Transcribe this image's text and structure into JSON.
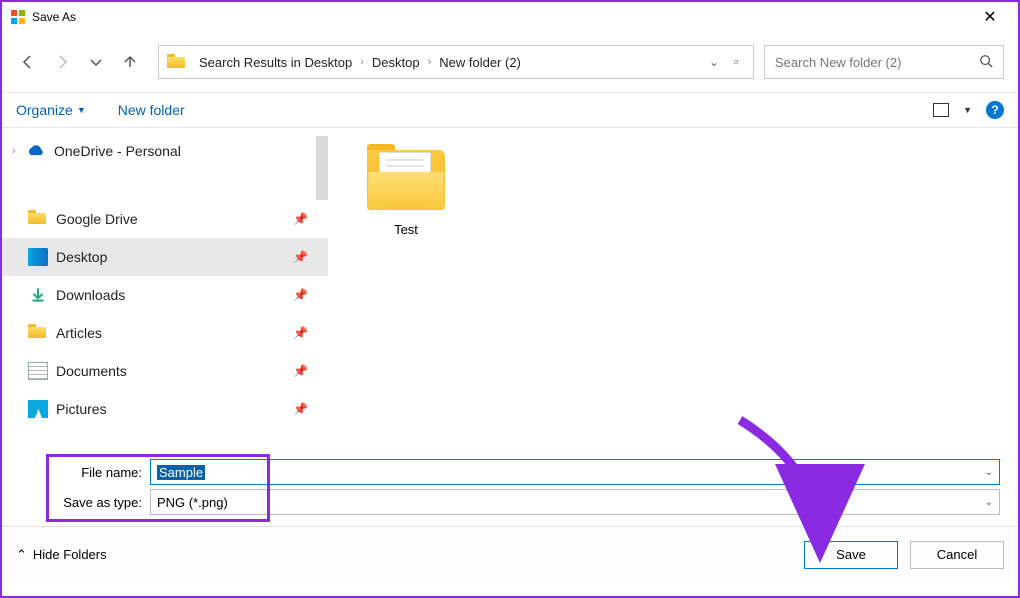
{
  "window": {
    "title": "Save As"
  },
  "breadcrumb": {
    "segments": [
      "Search Results in Desktop",
      "Desktop",
      "New folder (2)"
    ]
  },
  "search": {
    "placeholder": "Search New folder (2)"
  },
  "toolbar": {
    "organize": "Organize",
    "newfolder": "New folder"
  },
  "sidebar": {
    "onedrive": "OneDrive - Personal",
    "items": [
      {
        "label": "Google Drive"
      },
      {
        "label": "Desktop"
      },
      {
        "label": "Downloads"
      },
      {
        "label": "Articles"
      },
      {
        "label": "Documents"
      },
      {
        "label": "Pictures"
      }
    ]
  },
  "content": {
    "items": [
      {
        "label": "Test"
      }
    ]
  },
  "fields": {
    "filename_label": "File name:",
    "filename_value": "Sample",
    "saveastype_label": "Save as type:",
    "saveastype_value": "PNG (*.png)"
  },
  "footer": {
    "hidefolders": "Hide Folders",
    "save": "Save",
    "cancel": "Cancel"
  }
}
